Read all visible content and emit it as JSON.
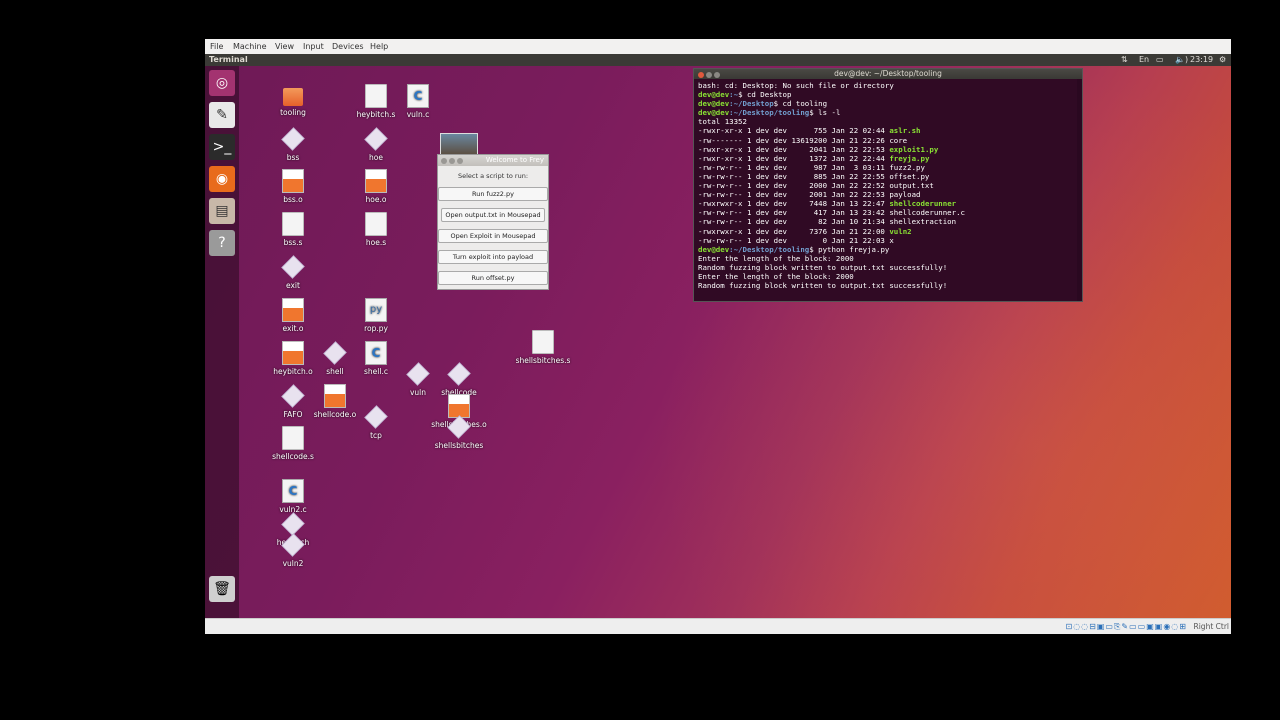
{
  "vm_menu": [
    "File",
    "Machine",
    "View",
    "Input",
    "Devices",
    "Help"
  ],
  "topbar": {
    "title": "Terminal",
    "indicators": [
      "⇅",
      "En",
      "▭",
      "🔈)",
      "23:19",
      "⚙"
    ]
  },
  "launcher": {
    "items": [
      {
        "name": "dash-icon",
        "glyph": "◎",
        "bg": "#a33370"
      },
      {
        "name": "text-editor-icon",
        "glyph": "✎",
        "bg": "#e8e8e8"
      },
      {
        "name": "terminal-icon",
        "glyph": ">_",
        "bg": "#2b2b2b"
      },
      {
        "name": "firefox-icon",
        "glyph": "◉",
        "bg": "#e86b1c"
      },
      {
        "name": "file-manager-icon",
        "glyph": "▤",
        "bg": "#c8b8a8"
      },
      {
        "name": "help-icon",
        "glyph": "?",
        "bg": "#9a9a9a"
      }
    ],
    "trash_glyph": "🗑"
  },
  "desktop_icons": [
    {
      "label": "tooling",
      "type": "folder"
    },
    {
      "label": "heybitch.s",
      "type": "file"
    },
    {
      "label": "vuln.c",
      "type": "c"
    },
    {
      "label": "bss",
      "type": "exec"
    },
    {
      "label": "hoe",
      "type": "exec"
    },
    {
      "label": "bss.o",
      "type": "orange"
    },
    {
      "label": "hoe.o",
      "type": "orange"
    },
    {
      "label": "bss.s",
      "type": "file"
    },
    {
      "label": "hoe.s",
      "type": "file"
    },
    {
      "label": "exit",
      "type": "exec"
    },
    {
      "label": "exit.o",
      "type": "orange"
    },
    {
      "label": "rop.py",
      "type": "py"
    },
    {
      "label": "shellsbitches.s",
      "type": "file"
    },
    {
      "label": "heybitch.o",
      "type": "orange"
    },
    {
      "label": "shell",
      "type": "exec"
    },
    {
      "label": "shell.c",
      "type": "c"
    },
    {
      "label": "vuln",
      "type": "exec"
    },
    {
      "label": "shellcode",
      "type": "exec"
    },
    {
      "label": "FAFO",
      "type": "exec"
    },
    {
      "label": "shellcode.o",
      "type": "orange"
    },
    {
      "label": "shellsbitches.o",
      "type": "orange"
    },
    {
      "label": "tcp",
      "type": "exec"
    },
    {
      "label": "shellsbitches",
      "type": "exec"
    },
    {
      "label": "shellcode.s",
      "type": "file"
    },
    {
      "label": "vuln2.c",
      "type": "c"
    },
    {
      "label": "heybitch",
      "type": "exec"
    },
    {
      "label": "vuln2",
      "type": "exec"
    }
  ],
  "dialog": {
    "title": "Welcome to Frey",
    "prompt": "Select a script to run:",
    "buttons": [
      "Run fuzz2.py",
      "Open output.txt in Mousepad",
      "Open Exploit in Mousepad",
      "Turn exploit into payload",
      "Run offset.py"
    ]
  },
  "terminal": {
    "title": "dev@dev: ~/Desktop/tooling",
    "lines": [
      {
        "t": "bash: cd: Desktop: No such file or directory"
      },
      {
        "p": "dev@dev",
        "w": ":~",
        "c": "$ cd Desktop"
      },
      {
        "p": "dev@dev",
        "w": ":~/Desktop",
        "c": "$ cd tooling"
      },
      {
        "p": "dev@dev",
        "w": ":~/Desktop/tooling",
        "c": "$ ls -l"
      },
      {
        "t": "total 13352"
      },
      {
        "t": "-rwxr-xr-x 1 dev dev      755 Jan 22 02:44 ",
        "g": "aslr.sh"
      },
      {
        "t": "-rw------- 1 dev dev 13619200 Jan 21 22:26 core"
      },
      {
        "t": "-rwxr-xr-x 1 dev dev     2041 Jan 22 22:53 ",
        "g": "exploit1.py"
      },
      {
        "t": "-rwxr-xr-x 1 dev dev     1372 Jan 22 22:44 ",
        "g": "freyja.py"
      },
      {
        "t": "-rw-rw-r-- 1 dev dev      987 Jan  3 03:11 fuzz2.py"
      },
      {
        "t": "-rw-rw-r-- 1 dev dev      885 Jan 22 22:55 offset.py"
      },
      {
        "t": "-rw-rw-r-- 1 dev dev     2000 Jan 22 22:52 output.txt"
      },
      {
        "t": "-rw-rw-r-- 1 dev dev     2001 Jan 22 22:53 payload"
      },
      {
        "t": "-rwxrwxr-x 1 dev dev     7448 Jan 13 22:47 ",
        "g": "shellcoderunner"
      },
      {
        "t": "-rw-rw-r-- 1 dev dev      417 Jan 13 23:42 shellcoderunner.c"
      },
      {
        "t": "-rw-rw-r-- 1 dev dev       82 Jan 10 21:34 shellextraction"
      },
      {
        "t": "-rwxrwxr-x 1 dev dev     7376 Jan 21 22:00 ",
        "g": "vuln2"
      },
      {
        "t": "-rw-rw-r-- 1 dev dev        0 Jan 21 22:03 x"
      },
      {
        "p": "dev@dev",
        "w": ":~/Desktop/tooling",
        "c": "$ python freyja.py"
      },
      {
        "t": "Enter the length of the block: 2000"
      },
      {
        "t": "Random fuzzing block written to output.txt successfully!"
      },
      {
        "t": "Enter the length of the block: 2000"
      },
      {
        "t": "Random fuzzing block written to output.txt successfully!"
      }
    ]
  },
  "statusbar": {
    "icons": "⊡◌◌⊟▣▭⎘✎▭▭▣▣◉◌⊞",
    "right_ctrl": "Right Ctrl"
  }
}
